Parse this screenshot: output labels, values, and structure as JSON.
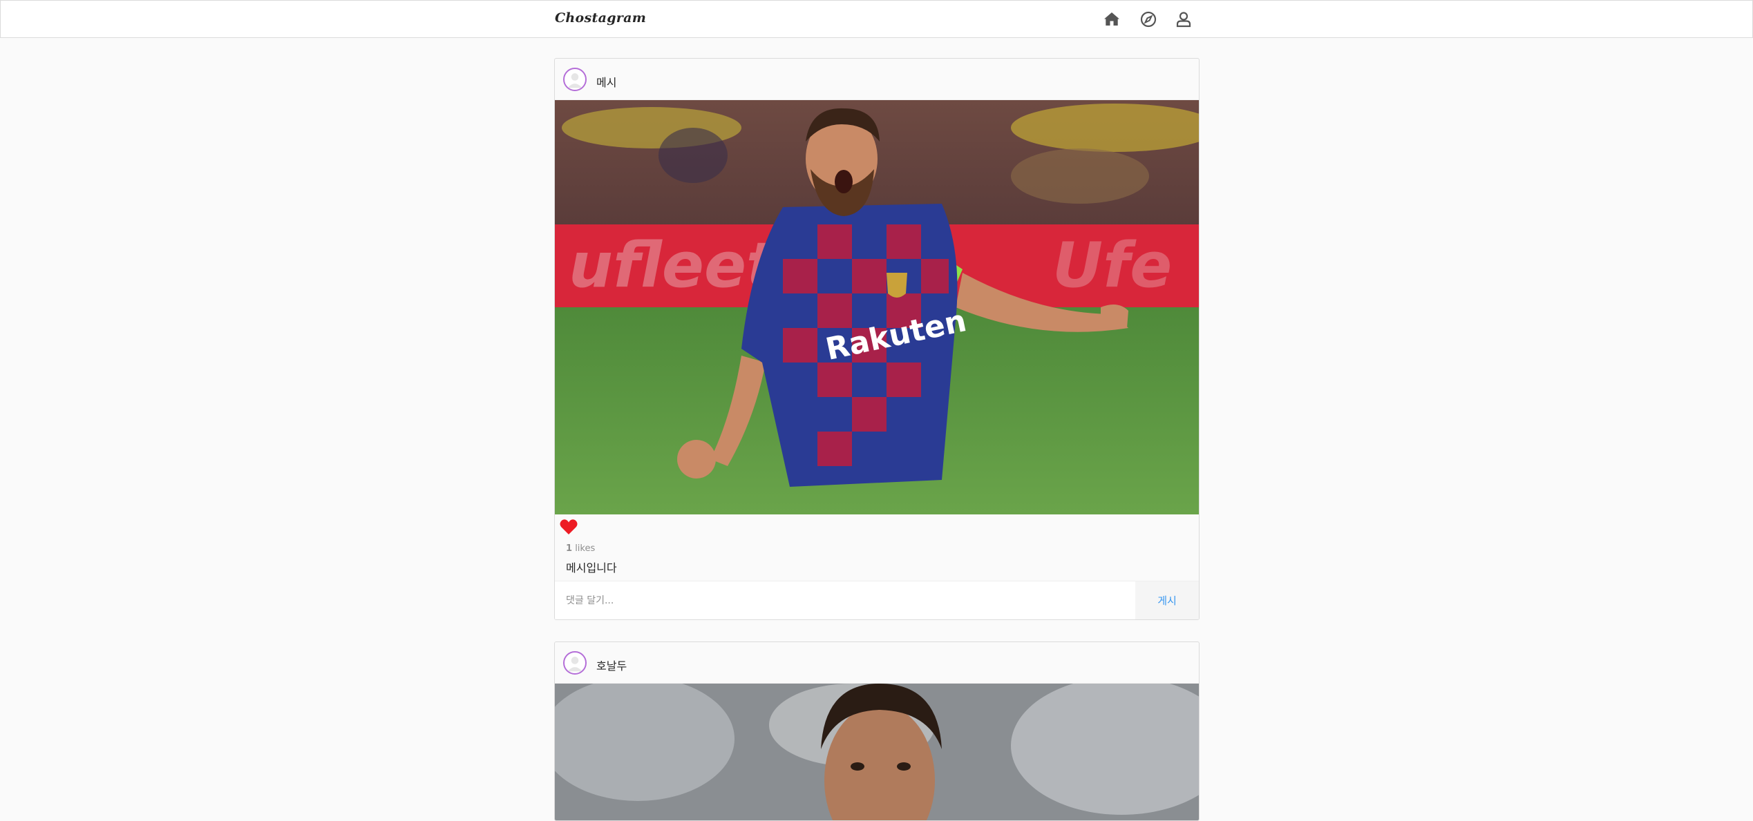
{
  "header": {
    "logo": "Chostagram",
    "icons": [
      "home-icon",
      "explore-icon",
      "profile-icon"
    ],
    "icon_color": "#555555"
  },
  "posts": [
    {
      "username": "메시",
      "likes_count": "1",
      "likes_label": "likes",
      "liked": true,
      "caption": "메시입니다",
      "comment_placeholder": "댓글 달기...",
      "post_button": "게시",
      "photo_text": "Rakuten"
    },
    {
      "username": "호날두"
    }
  ],
  "colors": {
    "heart": "#ed1c24",
    "post_button": "#3897f0",
    "avatar_ring": "#b46ed8"
  }
}
